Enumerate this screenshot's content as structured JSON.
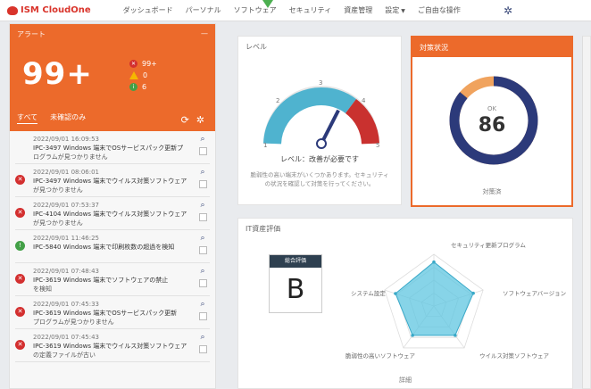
{
  "app": {
    "brand": "ISM CloudOne"
  },
  "nav": {
    "items": [
      "ダッシュボード",
      "パーソナル",
      "ソフトウェア",
      "セキュリティ",
      "資産管理",
      "設定",
      "ご自由な操作"
    ]
  },
  "alerts": {
    "title": "アラート",
    "total": "99+",
    "counts": {
      "critical": "99+",
      "warning": "0",
      "info": "6"
    },
    "tabs": [
      "すべて",
      "未確認のみ"
    ],
    "items": [
      {
        "severity": "none",
        "date": "2022/09/01 16:09:53",
        "msg": "IPC-3497 Windows 端末でOSサービスパック更新プ",
        "msg2": "ログラムが見つかりません"
      },
      {
        "severity": "red",
        "date": "2022/09/01 08:06:01",
        "msg": "IPC-3497 Windows 端末でウイルス対策ソフトウェア",
        "msg2": "が見つかりません"
      },
      {
        "severity": "red",
        "date": "2022/09/01 07:53:37",
        "msg": "IPC-4104 Windows 端末でウイルス対策ソフトウェア",
        "msg2": "が見つかりません"
      },
      {
        "severity": "green",
        "date": "2022/09/01 11:46:25",
        "msg": "IPC-5840 Windows 端末で印刷枚数の超過を検知",
        "msg2": ""
      },
      {
        "severity": "red",
        "date": "2022/09/01 07:48:43",
        "msg": "IPC-3619 Windows 端末でソフトウェアの禁止",
        "msg2": "を検知"
      },
      {
        "severity": "red",
        "date": "2022/09/01 07:45:33",
        "msg": "IPC-3619 Windows 端末でOSサービスパック更新",
        "msg2": "プログラムが見つかりません"
      },
      {
        "severity": "red",
        "date": "2022/09/01 07:45:43",
        "msg": "IPC-3619 Windows 端末でウイルス対策ソフトウェア",
        "msg2": "の定義ファイルが古い"
      }
    ]
  },
  "gauge_card": {
    "title": "レベル",
    "level_text": "レベル：改善が必要です",
    "description": "脆弱性の高い端末がいくつかあります。セキュリティの状況を確認して対策を行ってください。",
    "ticks": [
      "1",
      "2",
      "3",
      "4",
      "5"
    ],
    "value": 3.6
  },
  "donut_card": {
    "title": "対策状況",
    "caption": "OK",
    "center": "86",
    "percent": 86,
    "footer": "対策済"
  },
  "radar_card": {
    "title": "IT資産評価",
    "grade_head": "総合評価",
    "grade": "B",
    "axes": [
      "セキュリティ更新プログラム",
      "ソフトウェアバージョン",
      "ウイルス対策ソフトウェア",
      "脆弱性の高いソフトウェア",
      "システム設定"
    ],
    "values": [
      0.85,
      0.8,
      0.7,
      0.7,
      0.78
    ],
    "footer": "詳細"
  },
  "colors": {
    "accent": "#ec6a2b",
    "teal": "#4fb3cf",
    "red": "#d32f2f",
    "navy": "#2c3a7a"
  }
}
